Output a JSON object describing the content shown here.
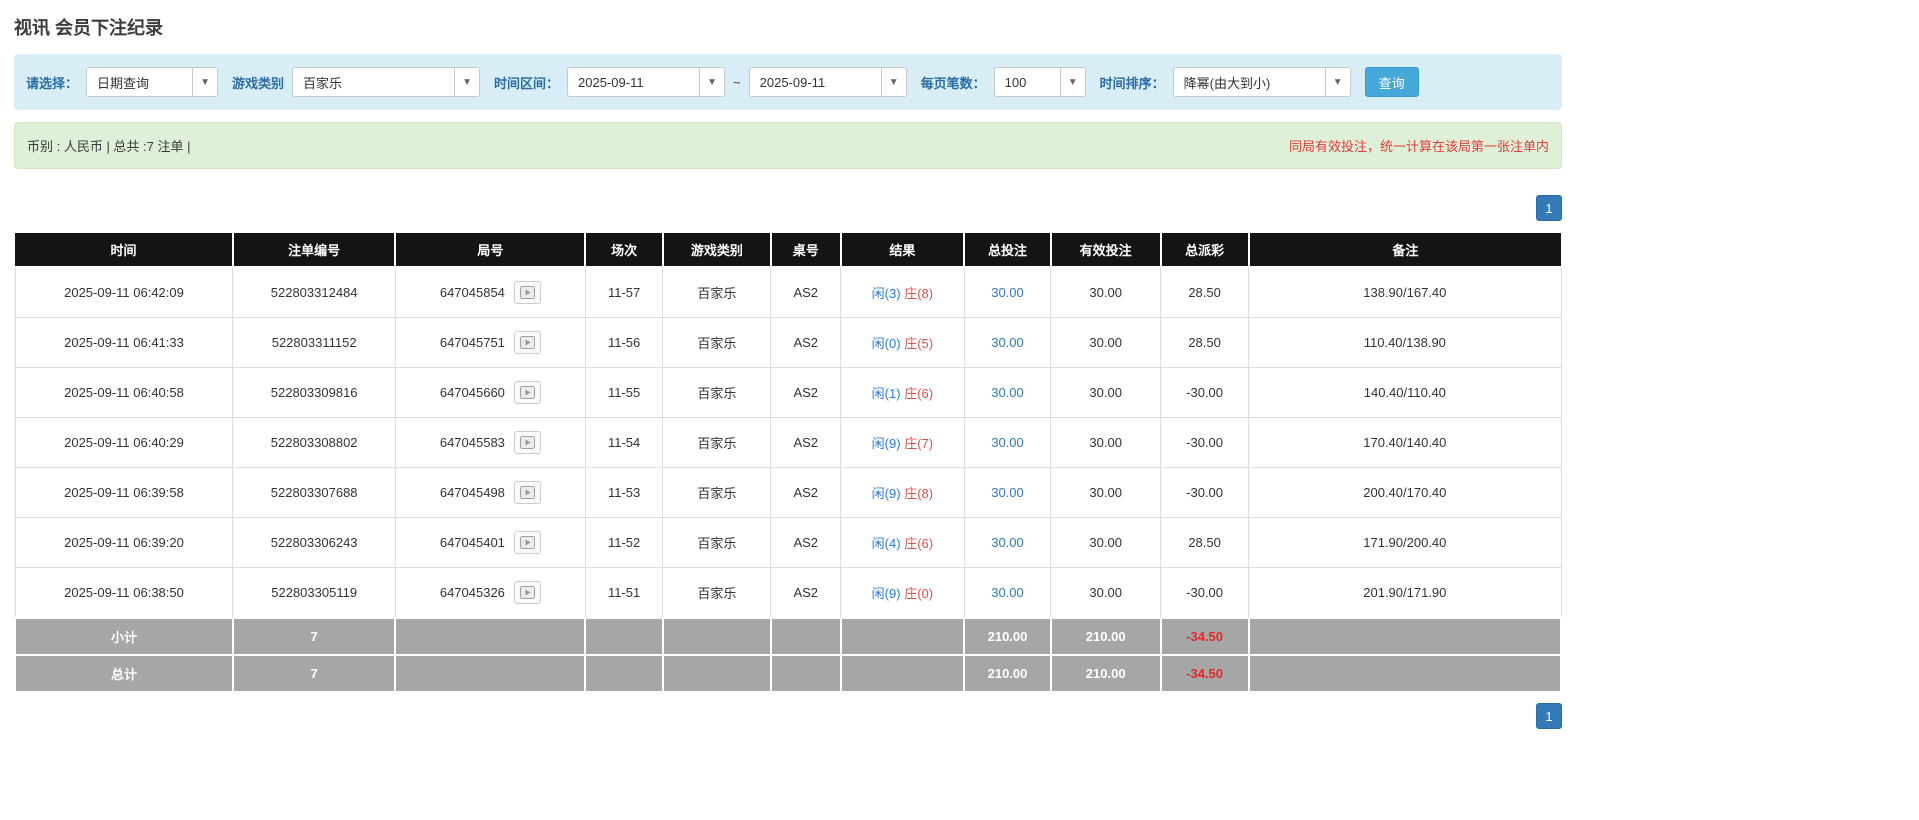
{
  "page": {
    "title": "视讯 会员下注纪录"
  },
  "filters": {
    "select_label": "请选择：",
    "select_value": "日期查询",
    "game_type_label": "游戏类别",
    "game_type_value": "百家乐",
    "date_range_label": "时间区间：",
    "date_from": "2025-09-11",
    "date_separator": "~",
    "date_to": "2025-09-11",
    "page_size_label": "每页笔数：",
    "page_size_value": "100",
    "sort_label": "时间排序：",
    "sort_value": "降幂(由大到小)",
    "search_button_label": "查询"
  },
  "summary": {
    "left_text": "币别 : 人民币 | 总共 :7 注单 |",
    "right_note": "同局有效投注，统一计算在该局第一张注单内"
  },
  "pagination": {
    "current_page": "1"
  },
  "table": {
    "headers": [
      "时间",
      "注单编号",
      "局号",
      "场次",
      "游戏类别",
      "桌号",
      "结果",
      "总投注",
      "有效投注",
      "总派彩",
      "备注"
    ],
    "rows": [
      {
        "time": "2025-09-11 06:42:09",
        "bet_id": "522803312484",
        "round": "647045854",
        "session": "11-57",
        "game": "百家乐",
        "table_no": "AS2",
        "result_player": "闲(3)",
        "result_banker": "庄(8)",
        "total_bet": "30.00",
        "valid_bet": "30.00",
        "payout": "28.50",
        "remark": "138.90/167.40"
      },
      {
        "time": "2025-09-11 06:41:33",
        "bet_id": "522803311152",
        "round": "647045751",
        "session": "11-56",
        "game": "百家乐",
        "table_no": "AS2",
        "result_player": "闲(0)",
        "result_banker": "庄(5)",
        "total_bet": "30.00",
        "valid_bet": "30.00",
        "payout": "28.50",
        "remark": "110.40/138.90"
      },
      {
        "time": "2025-09-11 06:40:58",
        "bet_id": "522803309816",
        "round": "647045660",
        "session": "11-55",
        "game": "百家乐",
        "table_no": "AS2",
        "result_player": "闲(1)",
        "result_banker": "庄(6)",
        "total_bet": "30.00",
        "valid_bet": "30.00",
        "payout": "-30.00",
        "remark": "140.40/110.40"
      },
      {
        "time": "2025-09-11 06:40:29",
        "bet_id": "522803308802",
        "round": "647045583",
        "session": "11-54",
        "game": "百家乐",
        "table_no": "AS2",
        "result_player": "闲(9)",
        "result_banker": "庄(7)",
        "total_bet": "30.00",
        "valid_bet": "30.00",
        "payout": "-30.00",
        "remark": "170.40/140.40"
      },
      {
        "time": "2025-09-11 06:39:58",
        "bet_id": "522803307688",
        "round": "647045498",
        "session": "11-53",
        "game": "百家乐",
        "table_no": "AS2",
        "result_player": "闲(9)",
        "result_banker": "庄(8)",
        "total_bet": "30.00",
        "valid_bet": "30.00",
        "payout": "-30.00",
        "remark": "200.40/170.40"
      },
      {
        "time": "2025-09-11 06:39:20",
        "bet_id": "522803306243",
        "round": "647045401",
        "session": "11-52",
        "game": "百家乐",
        "table_no": "AS2",
        "result_player": "闲(4)",
        "result_banker": "庄(6)",
        "total_bet": "30.00",
        "valid_bet": "30.00",
        "payout": "28.50",
        "remark": "171.90/200.40"
      },
      {
        "time": "2025-09-11 06:38:50",
        "bet_id": "522803305119",
        "round": "647045326",
        "session": "11-51",
        "game": "百家乐",
        "table_no": "AS2",
        "result_player": "闲(9)",
        "result_banker": "庄(0)",
        "total_bet": "30.00",
        "valid_bet": "30.00",
        "payout": "-30.00",
        "remark": "201.90/171.90"
      }
    ],
    "subtotal": {
      "label": "小计",
      "count": "7",
      "total_bet": "210.00",
      "valid_bet": "210.00",
      "payout": "-34.50"
    },
    "total": {
      "label": "总计",
      "count": "7",
      "total_bet": "210.00",
      "valid_bet": "210.00",
      "payout": "-34.50"
    }
  },
  "colors": {
    "filter_bg": "#d9edf7",
    "summary_bg": "#dff0d8",
    "header_bg": "#141414",
    "totals_row_bg": "#a6a6a6",
    "accent_blue": "#337ab7",
    "search_button_blue": "#45a8d8",
    "result_player_blue": "#2b7bd3",
    "result_banker_red": "#d9534f",
    "negative_red": "#e03e3e"
  }
}
